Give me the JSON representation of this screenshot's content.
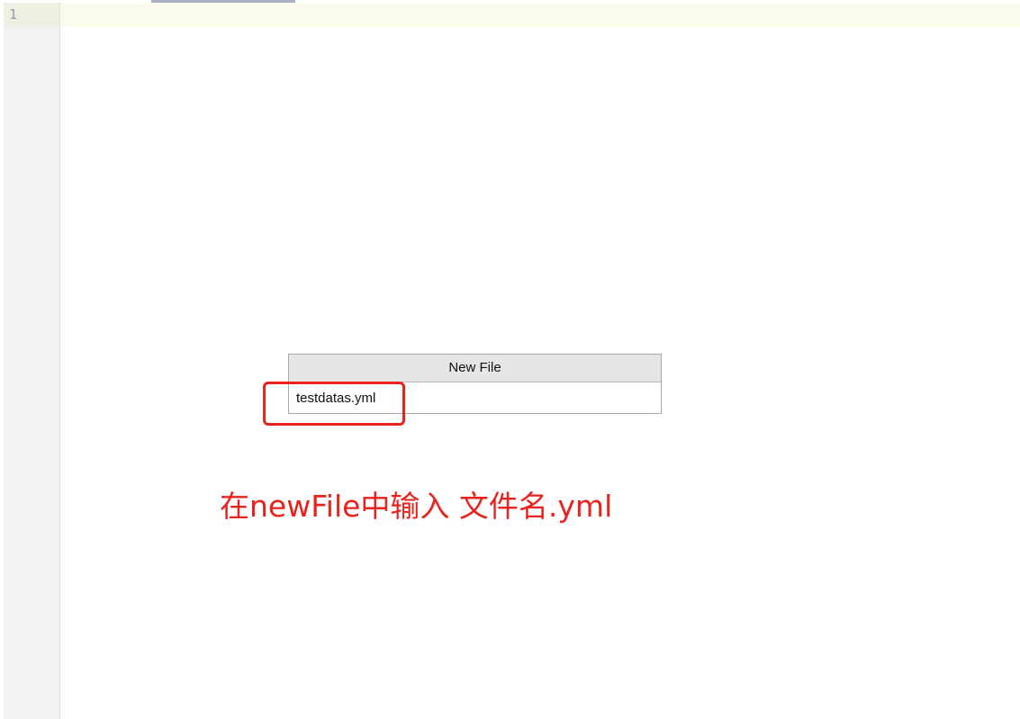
{
  "editor": {
    "line_numbers": [
      "1"
    ]
  },
  "dialog": {
    "title": "New File",
    "input_value": "testdatas.yml"
  },
  "annotation": {
    "text": "在newFile中输入 文件名.yml",
    "color": "#e8231d"
  }
}
